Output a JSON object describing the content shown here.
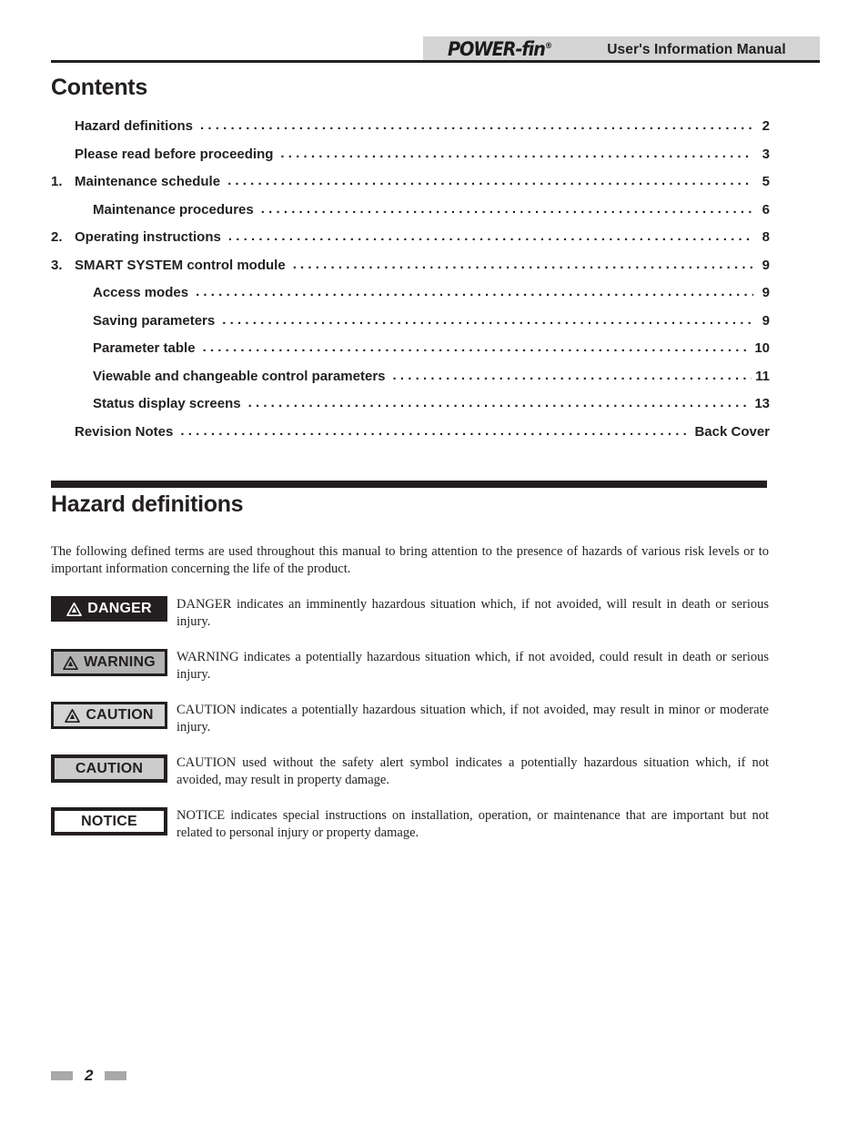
{
  "header": {
    "brand": "POWER-fin",
    "brand_mark": "®",
    "title": "User's Information Manual"
  },
  "contents": {
    "heading": "Contents",
    "items": [
      {
        "number": "",
        "label": "Hazard definitions",
        "page": "2",
        "indent": 0
      },
      {
        "number": "",
        "label": "Please read before proceeding",
        "page": "3",
        "indent": 0
      },
      {
        "number": "1.",
        "label": "Maintenance schedule",
        "page": "5",
        "indent": 0
      },
      {
        "number": "",
        "label": "Maintenance procedures",
        "page": "6",
        "indent": 2
      },
      {
        "number": "2.",
        "label": "Operating instructions",
        "page": "8",
        "indent": 0
      },
      {
        "number": "3.",
        "label": "SMART SYSTEM control module",
        "page": "9",
        "indent": 0
      },
      {
        "number": "",
        "label": "Access modes",
        "page": "9",
        "indent": 2
      },
      {
        "number": "",
        "label": "Saving parameters",
        "page": "9",
        "indent": 2
      },
      {
        "number": "",
        "label": "Parameter table",
        "page": "10",
        "indent": 2
      },
      {
        "number": "",
        "label": "Viewable and changeable control parameters",
        "page": "11",
        "indent": 2
      },
      {
        "number": "",
        "label": "Status display screens",
        "page": "13",
        "indent": 2
      },
      {
        "number": "",
        "label": "Revision Notes",
        "page": "Back Cover",
        "indent": 0
      }
    ],
    "leader": "................................................................................"
  },
  "hazard_section": {
    "heading": "Hazard definitions",
    "intro": "The following defined terms are used throughout this manual to bring attention to the presence of hazards of various risk levels or to important information concerning the life of the product.",
    "items": [
      {
        "label": "DANGER",
        "icon": "warning-triangle-icon",
        "has_icon": true,
        "style": "danger",
        "description": "DANGER indicates an imminently hazardous situation which, if not avoided, will result in death or serious injury."
      },
      {
        "label": "WARNING",
        "icon": "warning-triangle-icon",
        "has_icon": true,
        "style": "warning",
        "description": "WARNING indicates a potentially hazardous situation which, if not avoided, could result in death or serious injury."
      },
      {
        "label": "CAUTION",
        "icon": "warning-triangle-icon",
        "has_icon": true,
        "style": "caution",
        "description": "CAUTION indicates a potentially hazardous situation which, if not avoided, may result in minor or moderate injury."
      },
      {
        "label": "CAUTION",
        "icon": "",
        "has_icon": false,
        "style": "caution-plain",
        "description": "CAUTION used without the safety alert symbol indicates a potentially hazardous situation which, if not avoided, may result in property damage."
      },
      {
        "label": "NOTICE",
        "icon": "",
        "has_icon": false,
        "style": "notice",
        "description": "NOTICE indicates special instructions on installation, operation, or maintenance that are important but not related to personal injury or property damage."
      }
    ]
  },
  "footer": {
    "page_number": "2"
  },
  "colors": {
    "ink": "#231f20",
    "header_band": "#d4d4d4",
    "badge_gray": "#cccccc",
    "footer_bar": "#a8a8a8"
  }
}
